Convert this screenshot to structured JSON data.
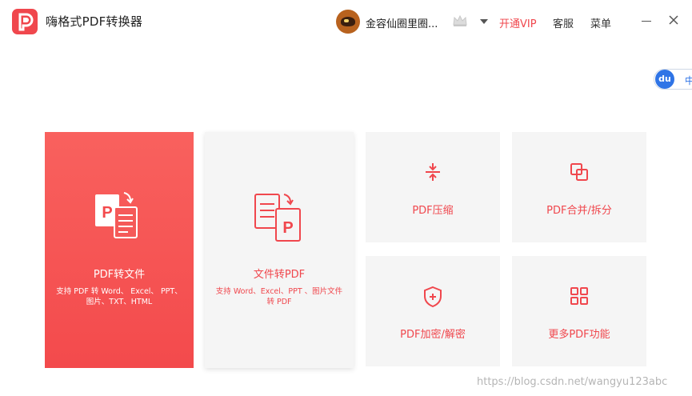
{
  "app": {
    "title": "嗨格式PDF转换器"
  },
  "header": {
    "username": "金容仙圈里圈...",
    "vip_label": "开通VIP",
    "service_label": "客服",
    "menu_label": "菜单"
  },
  "badge": {
    "icon_text": "du",
    "text": "中"
  },
  "cards": {
    "pdf_to_file": {
      "title": "PDF转文件",
      "desc": "支持 PDF 转 Word、 Excel、 PPT、图片、TXT、HTML"
    },
    "file_to_pdf": {
      "title": "文件转PDF",
      "desc": "支持 Word、Excel、PPT 、图片文件转 PDF"
    },
    "compress": {
      "title": "PDF压缩"
    },
    "merge_split": {
      "title": "PDF合并/拆分"
    },
    "encrypt_decrypt": {
      "title": "PDF加密/解密"
    },
    "more": {
      "title": "更多PDF功能"
    }
  },
  "watermark": "https://blog.csdn.net/wangyu123abc",
  "colors": {
    "accent": "#f0474d",
    "card_bg": "#f5f5f5"
  }
}
